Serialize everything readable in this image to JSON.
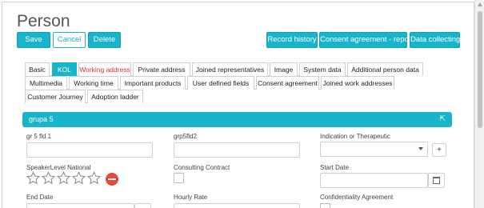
{
  "page": {
    "title": "Person"
  },
  "toolbar": {
    "save": "Save",
    "cancel": "Cancel",
    "delete": "Delete",
    "record_history": "Record history",
    "consent_report": "Consent agreement - report",
    "data_collecting": "Data collecting"
  },
  "tabs": {
    "row1": [
      "Basic",
      "KOL",
      "Working address",
      "Private address",
      "Joined representatives",
      "Image",
      "System data",
      "Additional person data"
    ],
    "row2": [
      "Multimedia",
      "Working time",
      "Important products",
      "User defined fields",
      "Consent agreement",
      "Joined work addresses"
    ],
    "row3": [
      "Customer Journey",
      "Adoption ladder"
    ],
    "active": "KOL"
  },
  "group": {
    "title": "grupa 5",
    "collapse_icon": "collapse-icon"
  },
  "fields": {
    "gr5fld1": {
      "label": "gr 5 fld 1",
      "value": ""
    },
    "grp5fld2": {
      "label": "grp5fld2",
      "value": ""
    },
    "indication": {
      "label": "Indication or Therapeutic",
      "value": "",
      "plus": "+"
    },
    "speaker_level": {
      "label": "SpeakerLevel National",
      "rating": 0,
      "max": 5
    },
    "consulting_contract": {
      "label": "Consulting Contract",
      "checked": false
    },
    "start_date": {
      "label": "Start Date",
      "value": ""
    },
    "end_date": {
      "label": "End Date",
      "value": ""
    },
    "hourly_rate": {
      "label": "Hourly Rate",
      "value": ""
    },
    "confidentiality": {
      "label": "Confidentiality Agreement",
      "checked": false
    }
  },
  "colors": {
    "accent": "#17b5c9",
    "danger": "#e44a3a",
    "tab_warning": "#e0302e"
  }
}
